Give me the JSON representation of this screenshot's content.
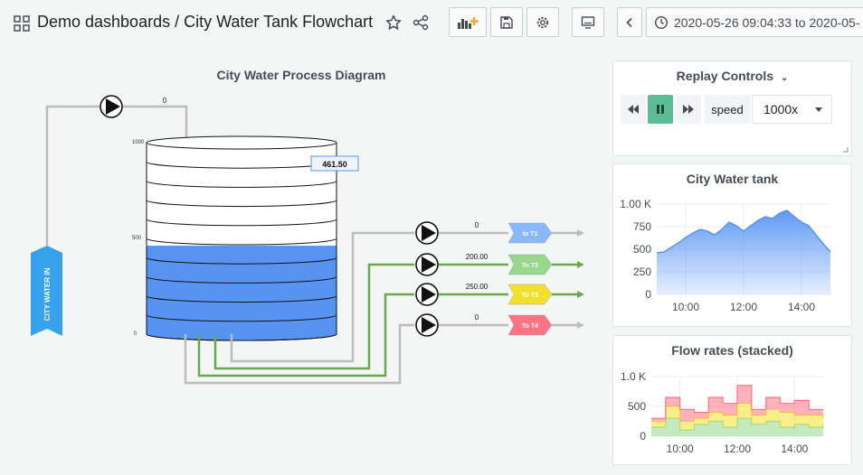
{
  "header": {
    "title": "Demo dashboards / City Water Tank Flowchart",
    "time_range": "2020-05-26 09:04:33 to 2020-05-"
  },
  "diagram": {
    "title": "City Water Process Diagram",
    "inlet_label": "CITY WATER IN",
    "inlet_flow": "0",
    "tank_level": "461.50",
    "scale": {
      "top": "1000",
      "mid": "500",
      "bottom": "0"
    },
    "level_fraction": 0.4615,
    "outputs": [
      {
        "flow": "0",
        "label": "to T1",
        "color": "#8ab8ff"
      },
      {
        "flow": "200.00",
        "label": "To T2",
        "color": "#96d98d"
      },
      {
        "flow": "250.00",
        "label": "To T3",
        "color": "#f2e02c"
      },
      {
        "flow": "0",
        "label": "To T4",
        "color": "#ff7383"
      }
    ]
  },
  "replay": {
    "title": "Replay Controls",
    "speed_label": "speed",
    "speed_value": "1000x"
  },
  "tank_chart": {
    "title": "City Water tank",
    "y_ticks": [
      "1.00 K",
      "750",
      "500",
      "250",
      "0"
    ],
    "x_ticks": [
      "10:00",
      "12:00",
      "14:00"
    ]
  },
  "flow_chart": {
    "title": "Flow rates (stacked)",
    "y_ticks": [
      "1.0 K",
      "500",
      "0"
    ],
    "x_ticks": [
      "10:00",
      "12:00",
      "14:00"
    ]
  },
  "chart_data": [
    {
      "type": "area",
      "title": "City Water tank",
      "x": [
        "09:00",
        "09:15",
        "09:30",
        "09:45",
        "10:00",
        "10:15",
        "10:30",
        "10:45",
        "11:00",
        "11:15",
        "11:30",
        "11:45",
        "12:00",
        "12:15",
        "12:30",
        "12:45",
        "13:00",
        "13:15",
        "13:30",
        "13:45",
        "14:00",
        "14:15",
        "14:30",
        "14:45",
        "15:00"
      ],
      "values": [
        460,
        470,
        520,
        570,
        630,
        680,
        720,
        700,
        660,
        720,
        800,
        760,
        700,
        760,
        820,
        860,
        840,
        900,
        930,
        860,
        800,
        760,
        660,
        560,
        470
      ],
      "ylim": [
        0,
        1000
      ],
      "color": "#5794f2"
    },
    {
      "type": "area",
      "title": "Flow rates (stacked)",
      "x": [
        "09:00",
        "09:30",
        "10:00",
        "10:30",
        "11:00",
        "11:30",
        "12:00",
        "12:30",
        "13:00",
        "13:30",
        "14:00",
        "14:30",
        "15:00"
      ],
      "series": [
        {
          "values": [
            150,
            300,
            100,
            200,
            250,
            150,
            300,
            200,
            250,
            150,
            200,
            150,
            200
          ],
          "color": "#96d98d"
        },
        {
          "values": [
            100,
            200,
            150,
            100,
            150,
            200,
            250,
            150,
            200,
            250,
            150,
            200,
            100
          ],
          "color": "#f2e02c"
        },
        {
          "values": [
            50,
            150,
            200,
            100,
            250,
            200,
            300,
            100,
            200,
            150,
            250,
            100,
            150
          ],
          "color": "#ff7383"
        }
      ],
      "ylim": [
        0,
        1000
      ],
      "stacked": true
    }
  ],
  "colors": {
    "accent": "#5cbd94",
    "tank_fill": "#5794f2",
    "pipe_grey": "#bcbcbc",
    "pipe_green": "#6aa84f",
    "inlet": "#36a2eb"
  }
}
